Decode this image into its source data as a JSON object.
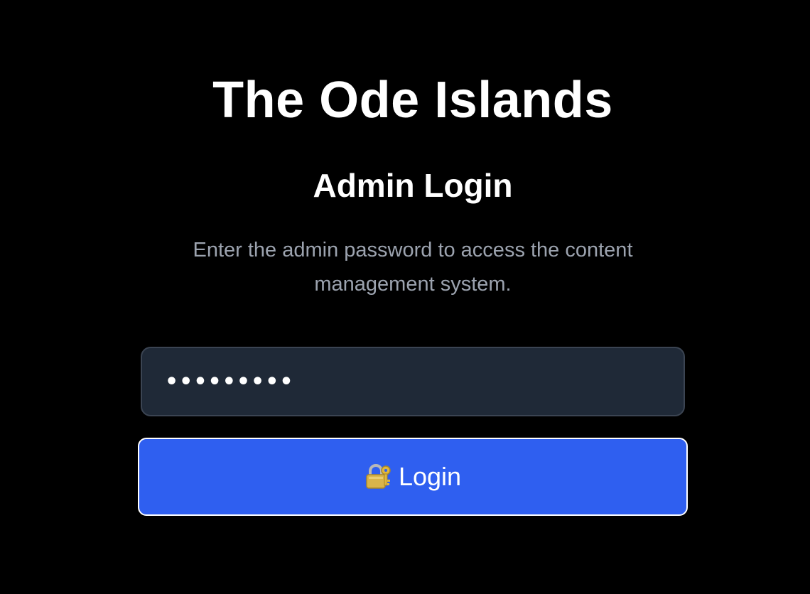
{
  "app": {
    "title": "The Ode Islands"
  },
  "login": {
    "heading": "Admin Login",
    "description": "Enter the admin password to access the content management system.",
    "password_value": "•••••••••",
    "button_label": "Login",
    "button_icon": "locked-with-key-icon"
  },
  "colors": {
    "background": "#000000",
    "field_background": "#1f2937",
    "button_background": "#2f5ff0",
    "description_text": "#9ca3af"
  }
}
